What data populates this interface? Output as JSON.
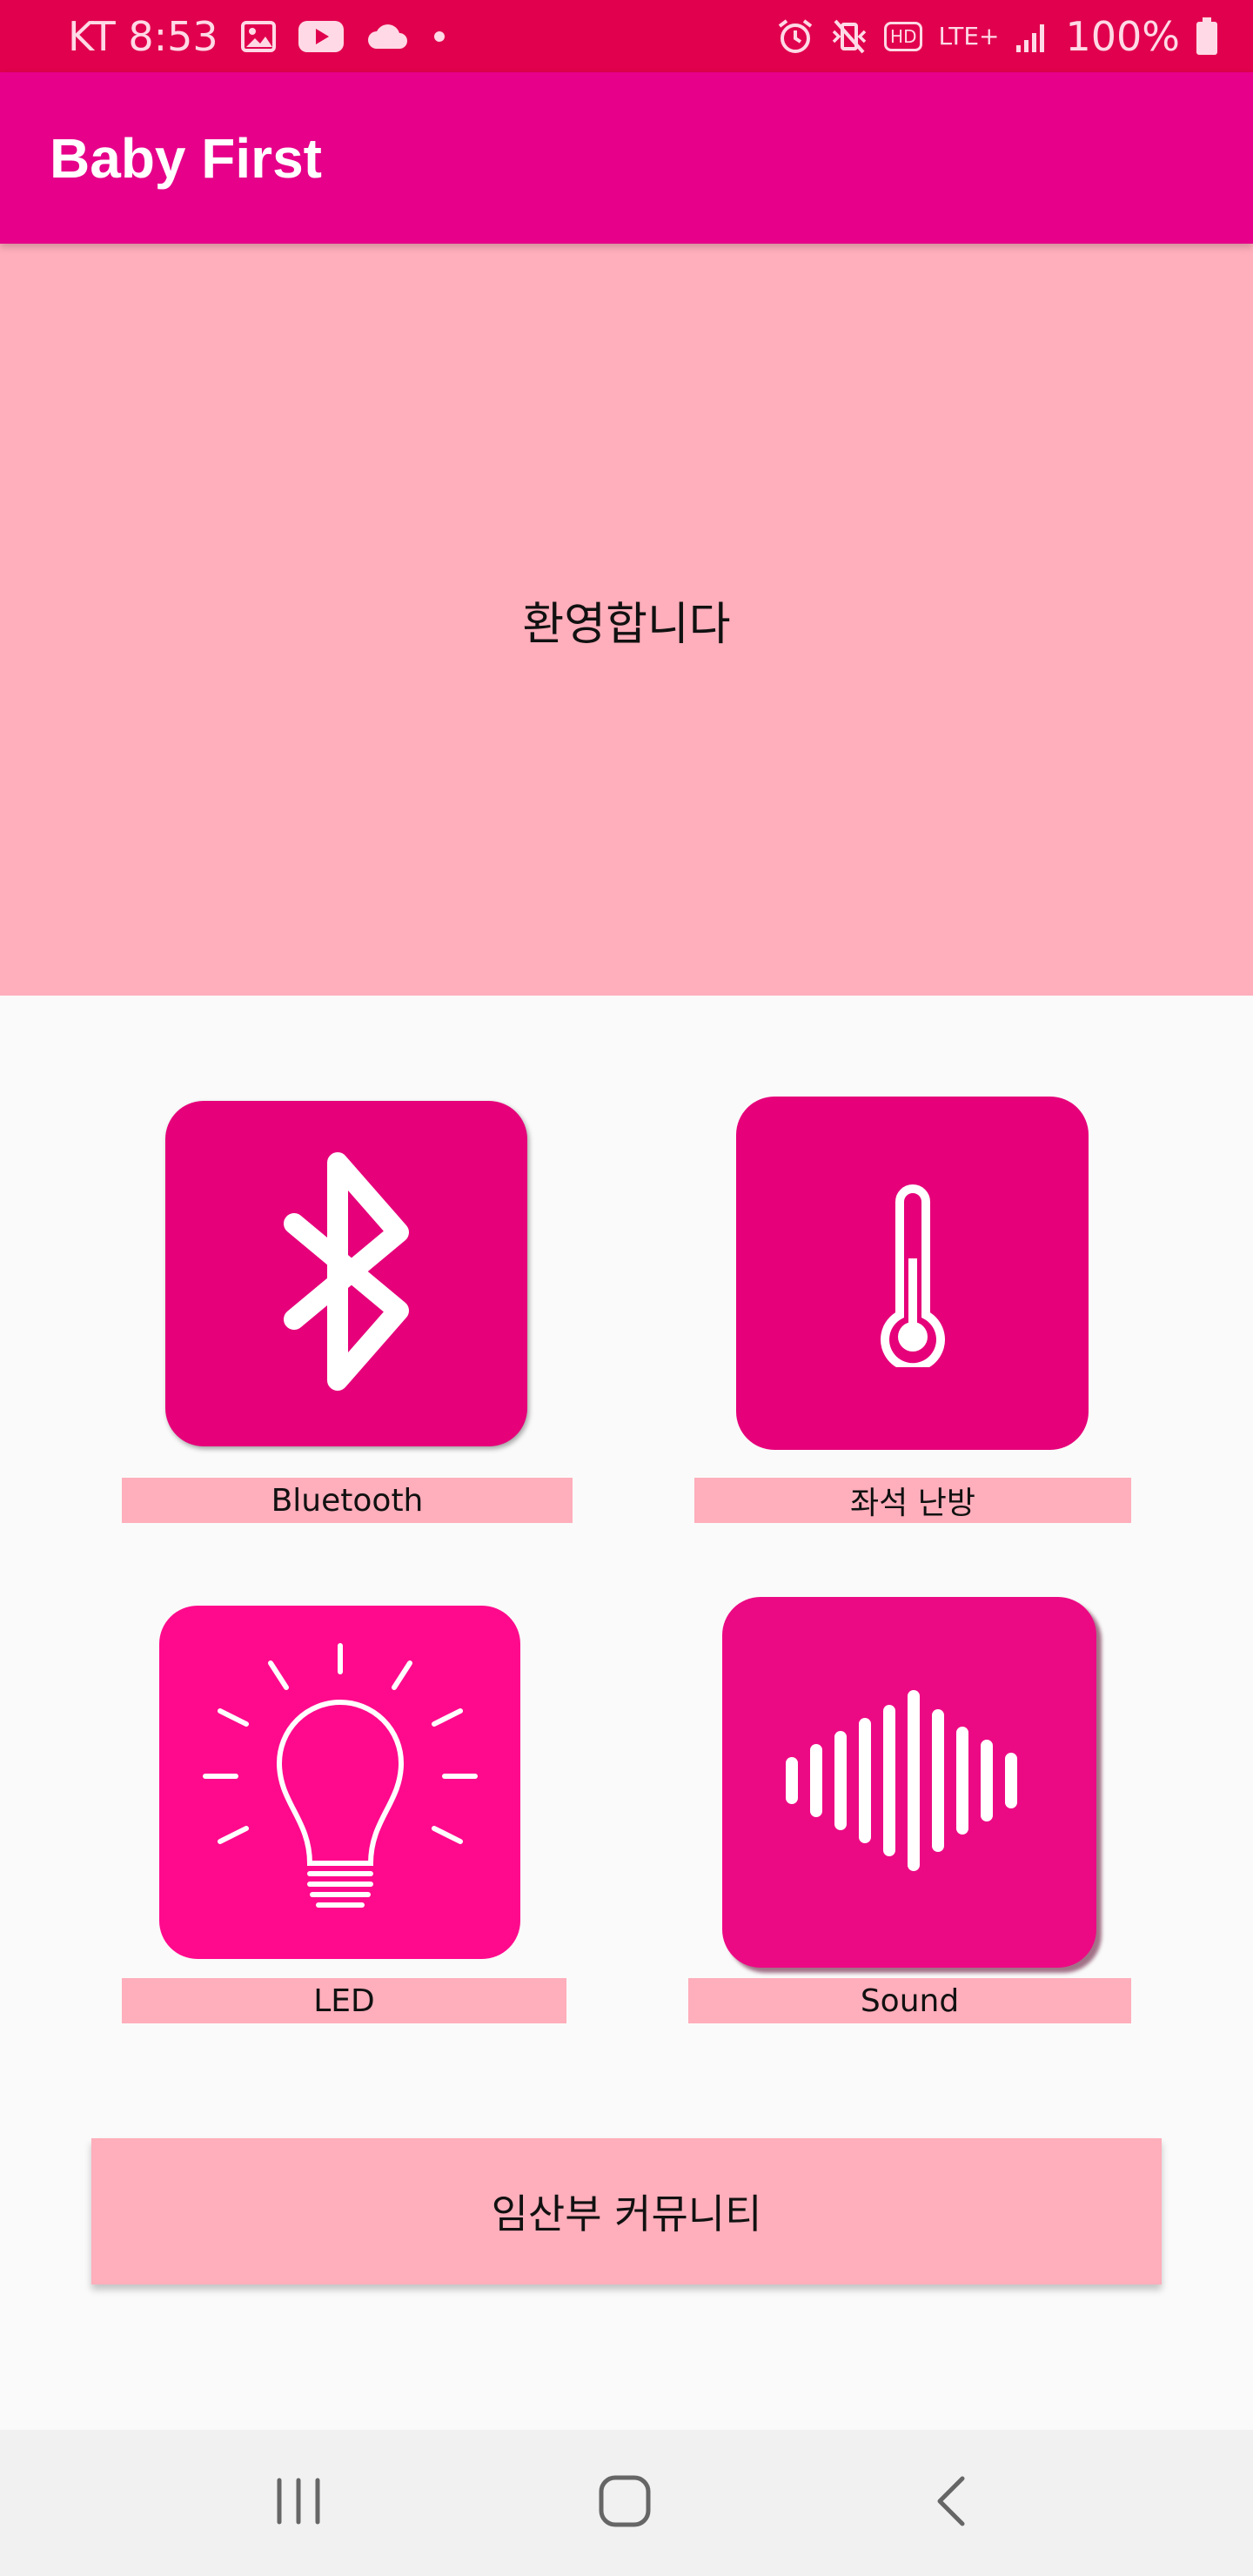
{
  "status_bar": {
    "carrier_time": "KT 8:53",
    "battery_percent": "100%",
    "left_icons": [
      "image-icon",
      "youtube-icon",
      "cloud-icon",
      "dot-icon"
    ],
    "right_icons": [
      "alarm-icon",
      "vibrate-icon",
      "hd-icon",
      "lte-icon",
      "signal-icon",
      "battery-icon"
    ],
    "hd_label": "HD",
    "lte_label": "LTE+"
  },
  "app_bar": {
    "title": "Baby First"
  },
  "welcome": {
    "text": "환영합니다"
  },
  "tiles": [
    {
      "label": "Bluetooth",
      "icon": "bluetooth-icon",
      "color": "#e6007a"
    },
    {
      "label": "좌석 난방",
      "icon": "thermometer-icon",
      "color": "#e6007a"
    },
    {
      "label": "LED",
      "icon": "lightbulb-icon",
      "color": "#ff0a8c"
    },
    {
      "label": "Sound",
      "icon": "sound-wave-icon",
      "color": "#ec0a84"
    }
  ],
  "community_button": {
    "label": "임산부 커뮤니티"
  },
  "nav_bar": {
    "buttons": [
      "recents-icon",
      "home-icon",
      "back-icon"
    ]
  },
  "colors": {
    "status_bar": "#e0004d",
    "app_bar": "#e6008a",
    "panel": "#ffaebb",
    "background": "#fafafa"
  }
}
